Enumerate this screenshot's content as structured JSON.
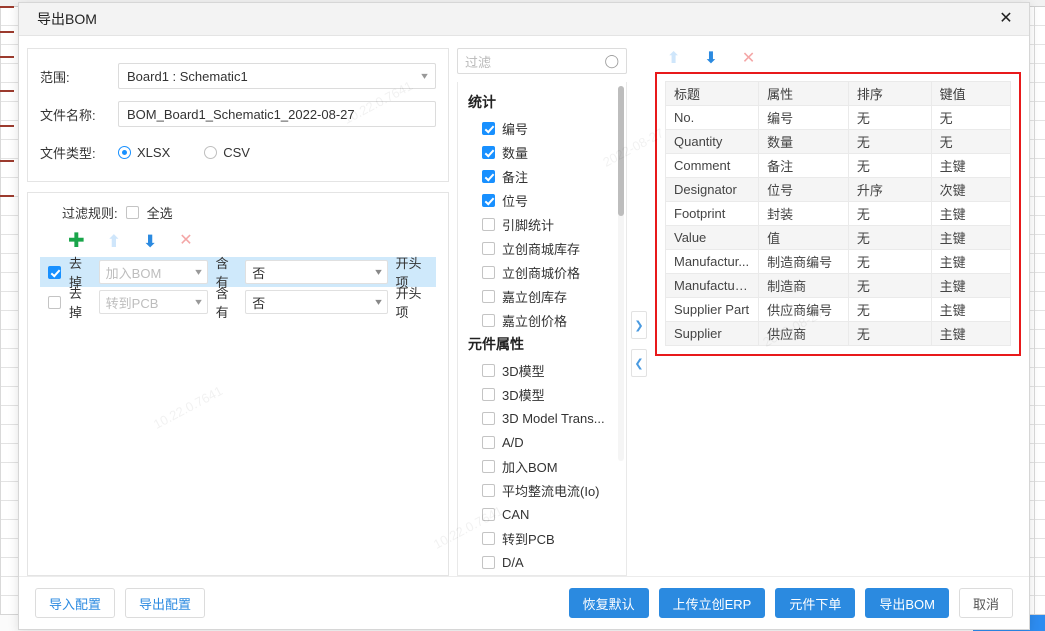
{
  "window": {
    "title": "导出BOM",
    "close_icon": "close-icon"
  },
  "form": {
    "scope_label": "范围:",
    "scope_value": "Board1 : Schematic1",
    "filename_label": "文件名称:",
    "filename_value": "BOM_Board1_Schematic1_2022-08-27",
    "filetype_label": "文件类型:",
    "filetype_options": [
      {
        "label": "XLSX",
        "checked": true
      },
      {
        "label": "CSV",
        "checked": false
      }
    ]
  },
  "rules": {
    "header_label": "过滤规则:",
    "select_all_label": "全选",
    "select_all_checked": false,
    "tools": [
      {
        "name": "add-rule-icon",
        "glyph": "✚",
        "class": "ic-plus"
      },
      {
        "name": "move-up-icon",
        "glyph": "⬆",
        "class": "ic-up-dis"
      },
      {
        "name": "move-down-icon",
        "glyph": "⬇",
        "class": "ic-down"
      },
      {
        "name": "delete-rule-icon",
        "glyph": "✕",
        "class": "ic-x"
      }
    ],
    "rows": [
      {
        "checked": true,
        "action": "去掉",
        "field": "加入BOM",
        "operator": "含有",
        "value": "否",
        "suffix": "开头项",
        "selected": true
      },
      {
        "checked": false,
        "action": "去掉",
        "field": "转到PCB",
        "operator": "含有",
        "value": "否",
        "suffix": "开头项",
        "selected": false
      }
    ]
  },
  "middle": {
    "filter_placeholder": "过滤",
    "search_icon": "search-icon",
    "groups": [
      {
        "title": "统计",
        "options": [
          {
            "label": "编号",
            "checked": true
          },
          {
            "label": "数量",
            "checked": true
          },
          {
            "label": "备注",
            "checked": true
          },
          {
            "label": "位号",
            "checked": true
          },
          {
            "label": "引脚统计",
            "checked": false
          },
          {
            "label": "立创商城库存",
            "checked": false
          },
          {
            "label": "立创商城价格",
            "checked": false
          },
          {
            "label": "嘉立创库存",
            "checked": false
          },
          {
            "label": "嘉立创价格",
            "checked": false
          }
        ]
      },
      {
        "title": "元件属性",
        "options": [
          {
            "label": "3D模型",
            "checked": false
          },
          {
            "label": "3D模型",
            "checked": false
          },
          {
            "label": "3D Model Trans...",
            "checked": false
          },
          {
            "label": "A/D",
            "checked": false
          },
          {
            "label": "加入BOM",
            "checked": false
          },
          {
            "label": "平均整流电流(Io)",
            "checked": false
          },
          {
            "label": "CAN",
            "checked": false
          },
          {
            "label": "转到PCB",
            "checked": false
          },
          {
            "label": "D/A",
            "checked": false
          }
        ]
      }
    ]
  },
  "collapse": {
    "expand_icon": "chevron-right-icon",
    "collapse_icon": "chevron-left-icon"
  },
  "table": {
    "tools": [
      {
        "name": "move-up-icon",
        "glyph": "⬆",
        "class": "ic-up-dis"
      },
      {
        "name": "move-down-icon",
        "glyph": "⬇",
        "class": "ic-down"
      },
      {
        "name": "delete-column-icon",
        "glyph": "✕",
        "class": "ic-x"
      }
    ],
    "highlight_color": "#e8191b",
    "headers": [
      "标题",
      "属性",
      "排序",
      "键值"
    ],
    "rows": [
      [
        "No.",
        "编号",
        "无",
        "无"
      ],
      [
        "Quantity",
        "数量",
        "无",
        "无"
      ],
      [
        "Comment",
        "备注",
        "无",
        "主键"
      ],
      [
        "Designator",
        "位号",
        "升序",
        "次键"
      ],
      [
        "Footprint",
        "封装",
        "无",
        "主键"
      ],
      [
        "Value",
        "值",
        "无",
        "主键"
      ],
      [
        "Manufactur...",
        "制造商编号",
        "无",
        "主键"
      ],
      [
        "Manufacturer",
        "制造商",
        "无",
        "主键"
      ],
      [
        "Supplier Part",
        "供应商编号",
        "无",
        "主键"
      ],
      [
        "Supplier",
        "供应商",
        "无",
        "主键"
      ]
    ]
  },
  "footer": {
    "left_buttons": [
      {
        "label": "导入配置",
        "style": "ghost"
      },
      {
        "label": "导出配置",
        "style": "ghost"
      }
    ],
    "right_buttons": [
      {
        "label": "恢复默认",
        "style": "primary"
      },
      {
        "label": "上传立创ERP",
        "style": "primary"
      },
      {
        "label": "元件下单",
        "style": "primary"
      },
      {
        "label": "导出BOM",
        "style": "primary"
      },
      {
        "label": "取消",
        "style": "cancel"
      }
    ]
  },
  "watermarks": [
    "10.22.0.7641",
    "2022-08-27",
    "10.22.0.7641",
    "2022-08-27",
    "10.22.0.7641"
  ]
}
